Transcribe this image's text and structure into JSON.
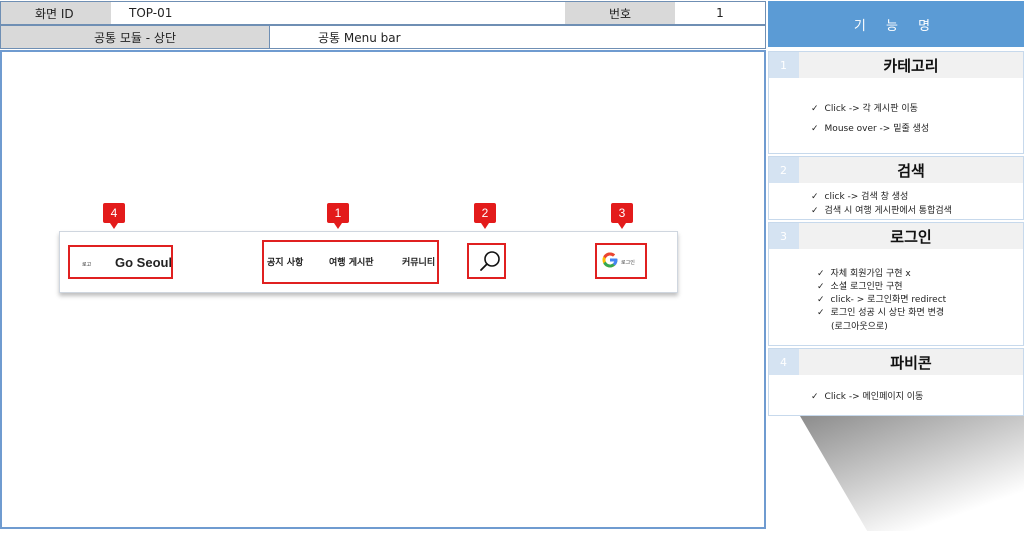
{
  "header": {
    "screen_id_label": "화면 ID",
    "screen_id_value": "TOP-01",
    "number_label": "번호",
    "number_value": "1",
    "module_label": "공통 모듈 - 상단",
    "module_value": "공통 Menu bar"
  },
  "mockup": {
    "logo_small": "로고",
    "logo_text": "Go Seoul",
    "menu": [
      "공지 사항",
      "여행 게시판",
      "커뮤니티"
    ],
    "login_label": "로그인",
    "badges": [
      "4",
      "1",
      "2",
      "3"
    ]
  },
  "panel": {
    "title": "기 능 명",
    "sections": [
      {
        "num": "1",
        "title": "카테고리",
        "lines": [
          "Click -> 각 게시판 이동",
          "Mouse over -> 밑줄 생성"
        ]
      },
      {
        "num": "2",
        "title": "검색",
        "lines": [
          "click -> 검색 창 생성",
          "검색 시 여행 게시판에서 통합검색"
        ]
      },
      {
        "num": "3",
        "title": "로그인",
        "lines": [
          "자체 회원가입 구현 x",
          "소셜 로그인만 구현",
          "click- > 로그인화면 redirect",
          "로그인 성공 시 상단 화면 변경",
          "(로그아웃으로)"
        ]
      },
      {
        "num": "4",
        "title": "파비콘",
        "lines": [
          "Click -> 메인페이지 이동"
        ]
      }
    ]
  },
  "colors": {
    "accent_blue": "#5b9bd5",
    "highlight_red": "#e02020",
    "google_blue": "#4285f4",
    "google_red": "#ea4335",
    "google_yellow": "#fbbc05",
    "google_green": "#34a853"
  }
}
